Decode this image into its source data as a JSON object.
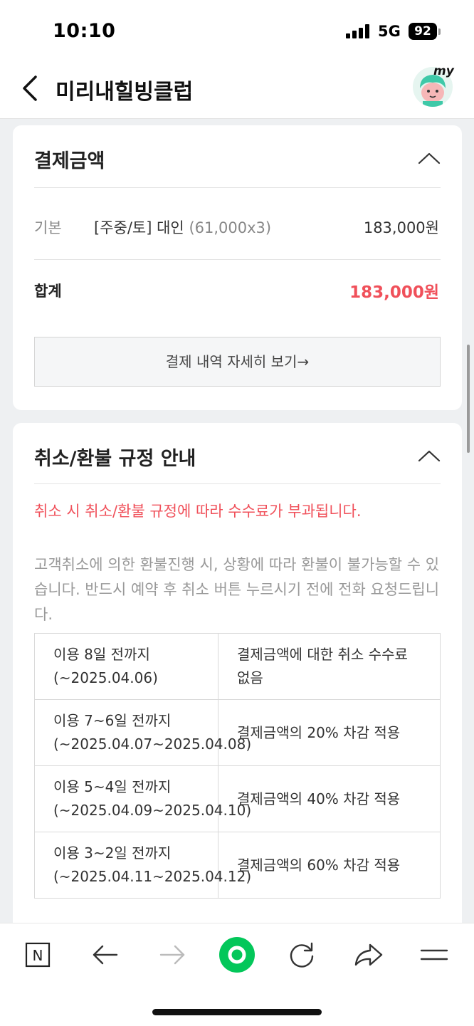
{
  "status_bar": {
    "time": "10:10",
    "network": "5G",
    "battery": "92"
  },
  "header": {
    "title": "미리내힐빙클럽",
    "avatar_label": "my"
  },
  "payment": {
    "title": "결제금액",
    "item_category": "기본",
    "item_name": "[주중/토] 대인",
    "item_qty": "(61,000x3)",
    "item_amount": "183,000원",
    "total_label": "합계",
    "total_amount": "183,000원",
    "detail_button": "결제 내역 자세히 보기→"
  },
  "refund": {
    "title": "취소/환불 규정 안내",
    "warning": "취소 시 취소/환불 규정에 따라 수수료가 부과됩니다.",
    "description": "고객취소에 의한 환불진행 시, 상황에 따라 환불이 불가능할 수 있습니다. 반드시 예약 후 취소 버튼 누르시기 전에 전화 요청드립니다.",
    "policies": [
      {
        "period": "이용 8일 전까지 (~2025.04.06)",
        "fee": "결제금액에 대한 취소 수수료 없음"
      },
      {
        "period": "이용 7~6일 전까지 (~2025.04.07~2025.04.08)",
        "fee": "결제금액의 20% 차감 적용"
      },
      {
        "period": "이용 5~4일 전까지 (~2025.04.09~2025.04.10)",
        "fee": "결제금액의 40% 차감 적용"
      },
      {
        "period": "이용 3~2일 전까지 (~2025.04.11~2025.04.12)",
        "fee": "결제금액의 60% 차감 적용"
      }
    ]
  },
  "toolbar": {
    "naver_label": "N"
  },
  "colors": {
    "accent_red": "#f0505a",
    "naver_green": "#03c75a"
  }
}
